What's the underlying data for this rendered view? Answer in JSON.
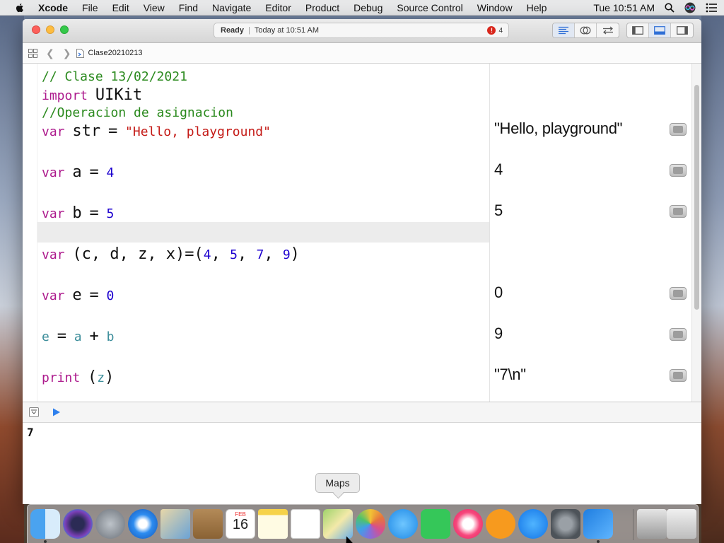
{
  "menubar": {
    "app_name": "Xcode",
    "items": [
      "File",
      "Edit",
      "View",
      "Find",
      "Navigate",
      "Editor",
      "Product",
      "Debug",
      "Source Control",
      "Window",
      "Help"
    ],
    "clock": "Tue 10:51 AM"
  },
  "toolbar": {
    "status": "Ready",
    "separator": "|",
    "time": "Today at 10:51 AM",
    "error_count": "4"
  },
  "jumpbar": {
    "file_name": "Clase20210213"
  },
  "editor": {
    "lines": {
      "l1": {
        "comment": "// Clase 13/02/2021"
      },
      "l2": {
        "kw": "import",
        "name": "UIKit"
      },
      "l3": {
        "comment": "//Operacion de asignacion"
      },
      "l4": {
        "kw": "var",
        "name": "str",
        "eq": "=",
        "str": "\"Hello, playground\""
      },
      "l5": {
        "kw": "var",
        "name": "a",
        "eq": "=",
        "num": "4"
      },
      "l6": {
        "kw": "var",
        "name": "b",
        "eq": "=",
        "num": "5"
      },
      "l7": {
        "kw": "var",
        "open": "(c, d, z, x)=(",
        "n1": "4",
        "c1": ", ",
        "n2": "5",
        "c2": ", ",
        "n3": "7",
        "c3": ", ",
        "n4": "9",
        "close": ")"
      },
      "l8": {
        "kw": "var",
        "name": "e",
        "eq": "=",
        "num": "0"
      },
      "l9": {
        "v1": "e",
        "eq": "=",
        "v2": "a",
        "plus": "+",
        "v3": "b"
      },
      "l10": {
        "fn": "print",
        "open": "(",
        "arg": "z",
        "close": ")"
      }
    }
  },
  "results": {
    "r_str": "\"Hello, playground\"",
    "r_a": "4",
    "r_b": "5",
    "r_e": "0",
    "r_sum": "9",
    "r_print": "\"7\\n\""
  },
  "console": {
    "output": "7"
  },
  "dock": {
    "tooltip": "Maps",
    "icons": [
      "finder-icon",
      "siri-icon",
      "launchpad-icon",
      "safari-icon",
      "mail-icon",
      "contacts-icon",
      "calendar-icon",
      "notes-icon",
      "reminders-icon",
      "maps-icon",
      "photos-icon",
      "messages-icon",
      "facetime-icon",
      "itunes-icon",
      "books-icon",
      "app-store-icon",
      "system-preferences-icon",
      "xcode-icon",
      "downloads-icon",
      "trash-icon"
    ],
    "calendar_month": "FEB",
    "calendar_day": "16"
  }
}
